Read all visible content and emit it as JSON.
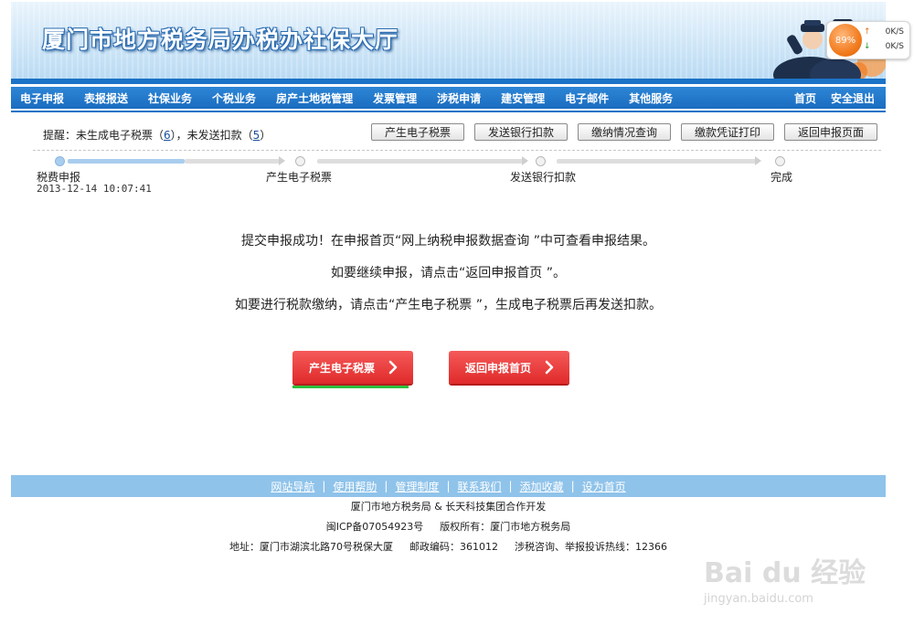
{
  "header": {
    "title": "厦门市地方税务局办税办社保大厅"
  },
  "speed_widget": {
    "percent": "89%",
    "up_arrow": "↑",
    "up": "0K/S",
    "down_arrow": "↓",
    "down": "0K/S"
  },
  "nav": {
    "items": [
      {
        "label": "电子申报"
      },
      {
        "label": "表报报送"
      },
      {
        "label": "社保业务"
      },
      {
        "label": "个税业务"
      },
      {
        "label": "房产土地税管理"
      },
      {
        "label": "发票管理"
      },
      {
        "label": "涉税申请"
      },
      {
        "label": "建安管理"
      },
      {
        "label": "电子邮件"
      },
      {
        "label": "其他服务"
      }
    ],
    "right": [
      {
        "label": "首页"
      },
      {
        "label": "安全退出"
      }
    ]
  },
  "reminder": {
    "prefix": "提醒：未生成电子税票（",
    "count1": "6",
    "middle": "），未发送扣款（",
    "count2": "5",
    "suffix": "）"
  },
  "toolbar": {
    "buttons": [
      {
        "label": "产生电子税票"
      },
      {
        "label": "发送银行扣款"
      },
      {
        "label": "缴纳情况查询"
      },
      {
        "label": "缴款凭证打印"
      },
      {
        "label": "返回申报页面"
      }
    ]
  },
  "steps": [
    {
      "label": "税费申报",
      "time": "2013-12-14 10:07:41",
      "done": true
    },
    {
      "label": "产生电子税票",
      "time": "",
      "done": false
    },
    {
      "label": "发送银行扣款",
      "time": "",
      "done": false
    },
    {
      "label": "完成",
      "time": "",
      "done": false
    }
  ],
  "messages": [
    "提交申报成功！在申报首页“网上纳税申报数据查询 ”中可查看申报结果。",
    "如要继续申报，请点击“返回申报首页 ”。",
    "如要进行税款缴纳，请点击“产生电子税票 ”，生成电子税票后再发送扣款。"
  ],
  "actions": {
    "generate": "产生电子税票",
    "back": "返回申报首页"
  },
  "footer": {
    "links": [
      {
        "label": "网站导航"
      },
      {
        "label": "使用帮助"
      },
      {
        "label": "管理制度"
      },
      {
        "label": "联系我们"
      },
      {
        "label": "添加收藏"
      },
      {
        "label": "设为首页"
      }
    ],
    "separator": "|",
    "dev": "厦门市地方税务局 & 长天科技集团合作开发",
    "icp": "闽ICP备07054923号",
    "copyright": "版权所有：厦门市地方税务局",
    "address": "地址：厦门市湖滨北路70号税保大厦",
    "postcode": "邮政编码：361012",
    "hotline": "涉税咨询、举报投诉热线：12366"
  },
  "watermark": {
    "brand": "Bai du 经验",
    "url": "jingyan.baidu.com"
  },
  "colors": {
    "nav_blue": "#1a6cc0",
    "action_red": "#e02a2a",
    "footer_blue": "#8fc3ea",
    "underline_green": "#2fbf3d"
  }
}
